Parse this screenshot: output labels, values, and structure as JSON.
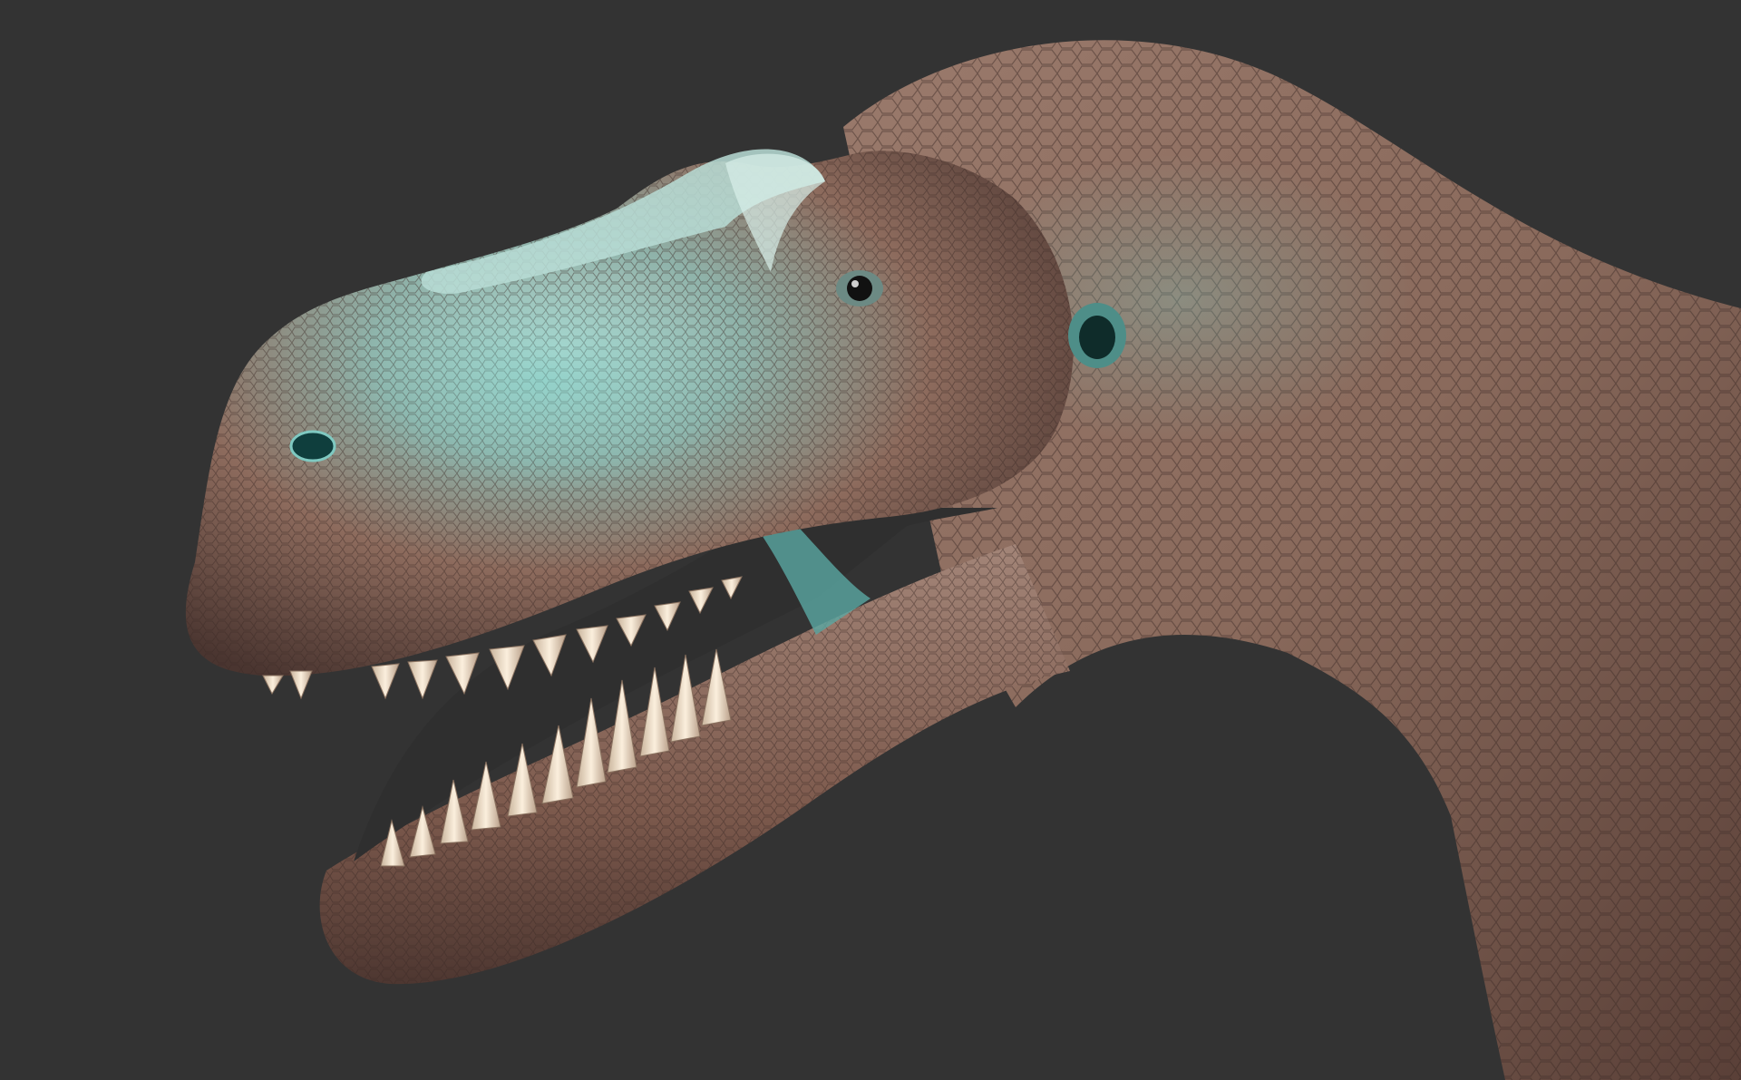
{
  "scene": {
    "subject": "dinosaur-head-sculpt",
    "colors": {
      "background": "#333333",
      "skin_light": "#a9c9c0",
      "skin_teal": "#5fa6a0",
      "skin_copper": "#8a5a4a",
      "skin_dark": "#4a3530",
      "teeth": "#efe0cc",
      "mouth_inside": "#3a3a3a",
      "eye": "#111111"
    }
  }
}
